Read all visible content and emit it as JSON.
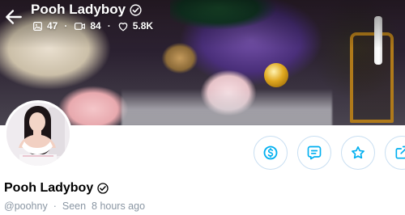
{
  "header": {
    "title": "Pooh Ladyboy",
    "stats": {
      "photos": "47",
      "videos": "84",
      "likes": "5.8K"
    }
  },
  "profile": {
    "name": "Pooh Ladyboy",
    "handle": "@poohny",
    "seen": "Seen  8 hours ago"
  },
  "actions": [
    "tip",
    "message",
    "favorite",
    "share"
  ],
  "colors": {
    "accent": "#00aff0",
    "muted": "#8a96a3",
    "button_border": "#c9dff2"
  }
}
